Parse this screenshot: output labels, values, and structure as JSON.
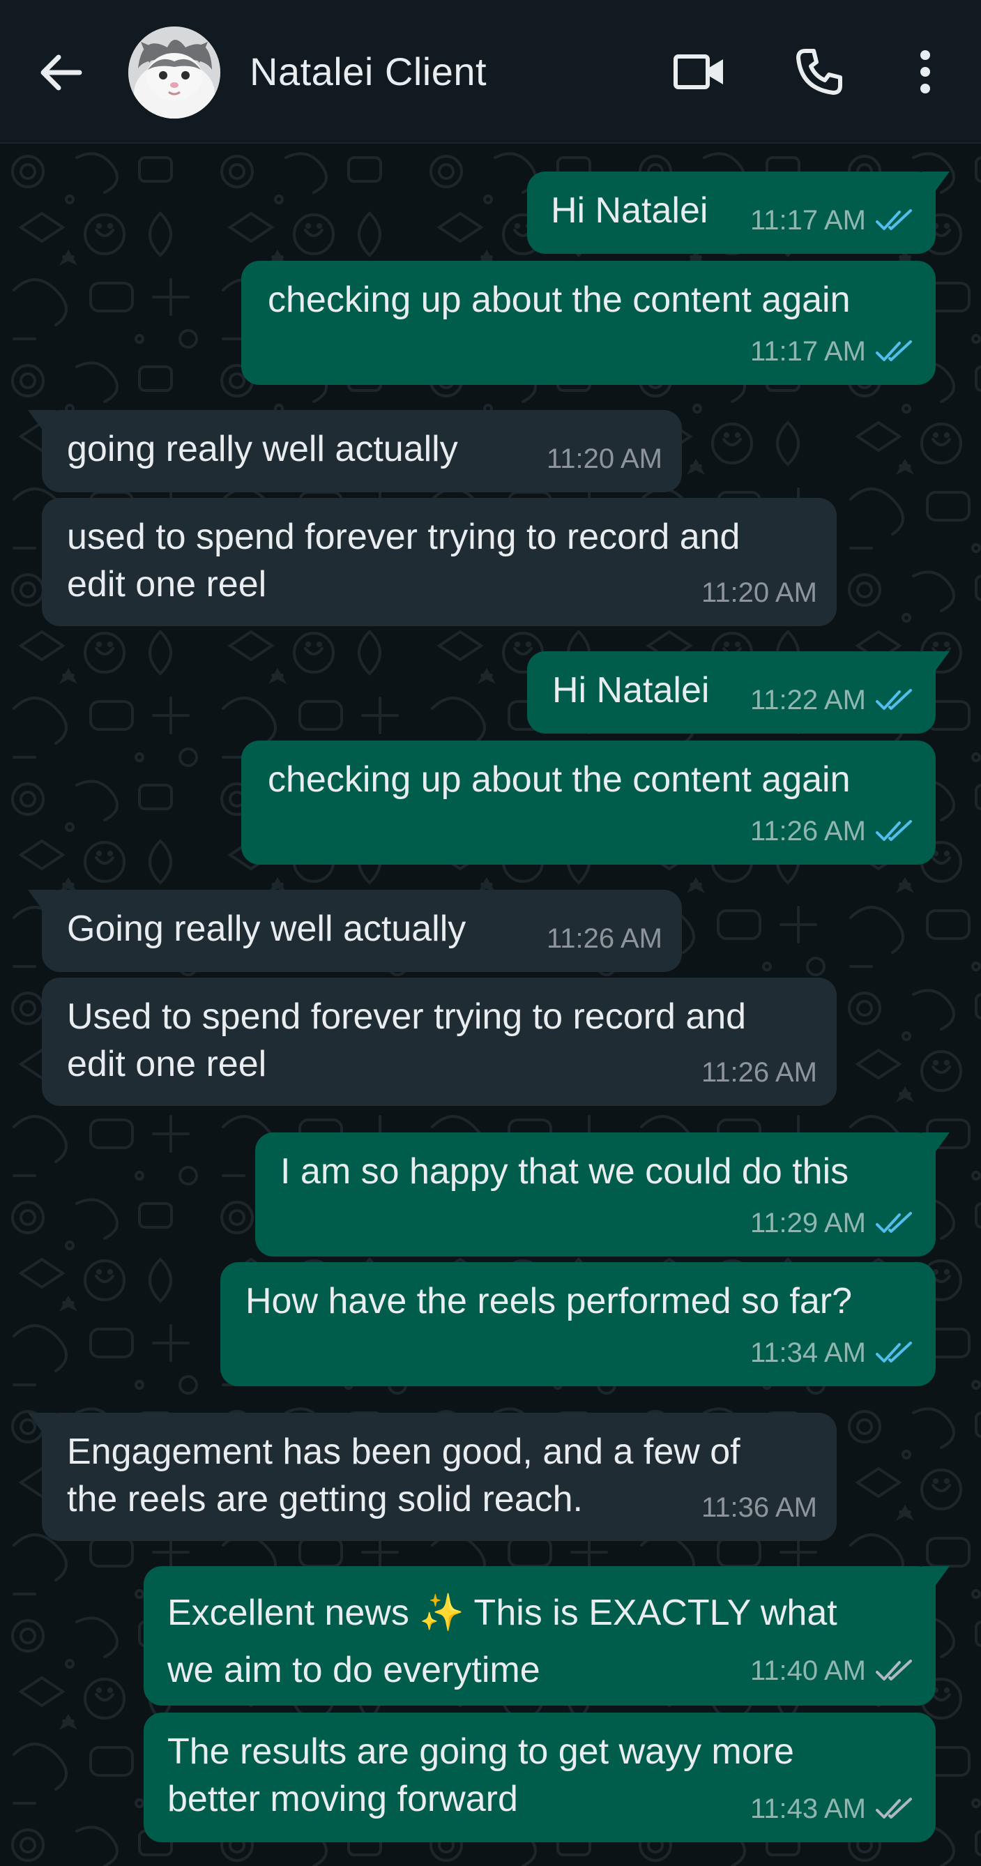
{
  "header": {
    "contact_name": "Natalei Client",
    "back_icon": "arrow-left-icon",
    "video_icon": "video-call-icon",
    "call_icon": "phone-icon",
    "menu_icon": "more-vert-icon"
  },
  "colors": {
    "header_bg": "#101a20",
    "chat_bg": "#0c1317",
    "outgoing_bubble": "#005c4b",
    "incoming_bubble": "#202c33",
    "read_tick": "#53bdeb",
    "delivered_tick": "#aebac1"
  },
  "messages": [
    {
      "direction": "out",
      "text": "Hi Natalei",
      "time": "11:17 AM",
      "status": "read"
    },
    {
      "direction": "out",
      "text": "checking up about the content again",
      "time": "11:17 AM",
      "status": "read"
    },
    {
      "direction": "in",
      "text": "going really well actually",
      "time": "11:20 AM"
    },
    {
      "direction": "in",
      "text": "used to spend forever trying to record and\nedit one reel",
      "time": "11:20 AM"
    },
    {
      "direction": "out",
      "text": "Hi Natalei",
      "time": "11:22 AM",
      "status": "read"
    },
    {
      "direction": "out",
      "text": "checking up about the content again",
      "time": "11:26 AM",
      "status": "read"
    },
    {
      "direction": "in",
      "text": "Going really well actually",
      "time": "11:26 AM"
    },
    {
      "direction": "in",
      "text": "Used to spend forever trying to record and\nedit one reel",
      "time": "11:26 AM"
    },
    {
      "direction": "out",
      "text": "I am so happy that we could do this",
      "time": "11:29 AM",
      "status": "read"
    },
    {
      "direction": "out",
      "text": "How have the reels performed so far?",
      "time": "11:34 AM",
      "status": "read"
    },
    {
      "direction": "in",
      "text": "Engagement has been good, and a few of\nthe reels are getting solid reach.",
      "time": "11:36 AM"
    },
    {
      "direction": "out",
      "text_before_emoji": "Excellent news ",
      "emoji": "✨",
      "text_after_emoji": " This is EXACTLY what\nwe aim to do everytime",
      "time": "11:40 AM",
      "status": "delivered"
    },
    {
      "direction": "out",
      "text": "The results are going to get wayy more\nbetter moving forward",
      "time": "11:43 AM",
      "status": "delivered"
    }
  ]
}
